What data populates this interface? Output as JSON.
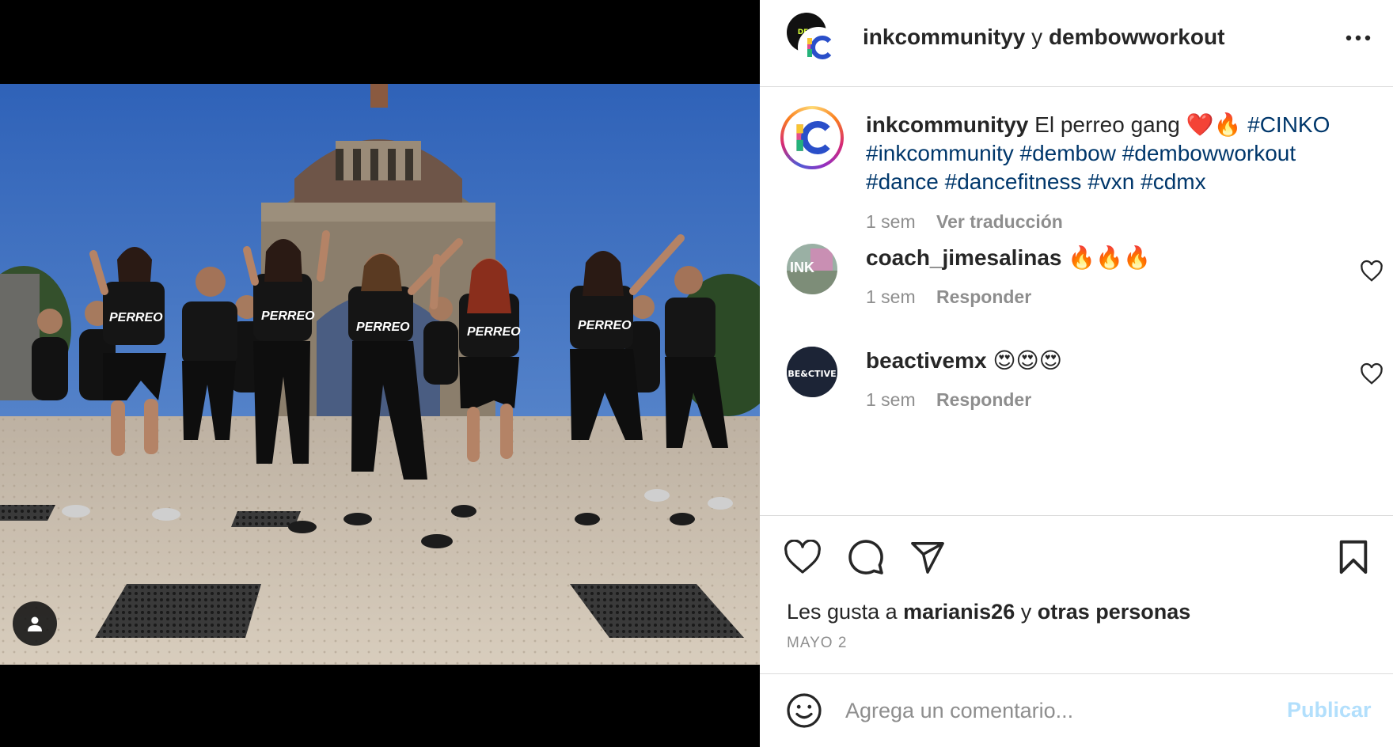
{
  "header": {
    "user1": "inkcommunityy",
    "connector": "y",
    "user2": "dembowworkout",
    "back_avatar_text": "DEM"
  },
  "caption": {
    "user": "inkcommunityy",
    "text": "El perreo gang ❤️🔥",
    "hashtags": "#CINKO #inkcommunity #dembow #dembowworkout #dance #dancefitness #vxn #cdmx",
    "time": "1 sem",
    "translate_label": "Ver traducción",
    "avatar_letters": "IC"
  },
  "comments": [
    {
      "user": "coach_jimesalinas",
      "text": "🔥🔥🔥",
      "time": "1 sem",
      "reply_label": "Responder",
      "avatar_text": "INK"
    },
    {
      "user": "beactivemx",
      "text": "😍😍😍",
      "time": "1 sem",
      "reply_label": "Responder",
      "avatar_text": "BE&CTIVE"
    }
  ],
  "photo": {
    "shirt_text": "PERREO"
  },
  "likes": {
    "prefix": "Les gusta a",
    "user": "marianis26",
    "connector": "y",
    "others": "otras personas"
  },
  "date": "MAYO 2",
  "add_comment": {
    "placeholder": "Agrega un comentario...",
    "post_label": "Publicar"
  },
  "icons": {
    "more": "more-horizontal-icon",
    "like": "heart-icon",
    "comment": "comment-bubble-icon",
    "share": "paper-plane-icon",
    "save": "bookmark-icon",
    "emoji": "smiley-icon",
    "tag": "user-tag-icon"
  },
  "colors": {
    "link": "#00376b",
    "muted": "#8e8e8e",
    "post_disabled": "#b2dffc",
    "divider": "#dbdbdb"
  }
}
